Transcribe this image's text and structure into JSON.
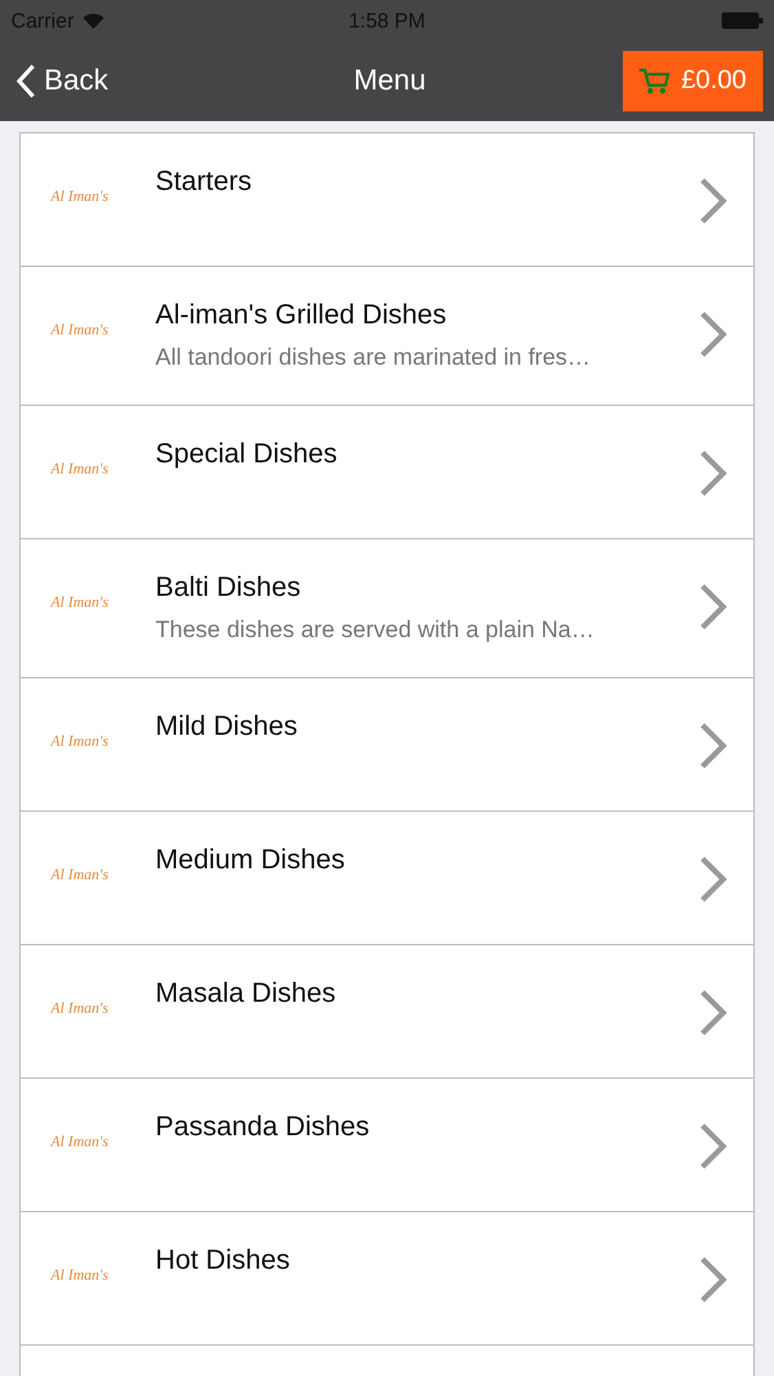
{
  "status_bar": {
    "carrier": "Carrier",
    "time": "1:58 PM"
  },
  "nav": {
    "back": "Back",
    "title": "Menu",
    "cart_total": "£0.00"
  },
  "items": [
    {
      "logo": "Al Iman's",
      "title": "Starters"
    },
    {
      "logo": "Al Iman's",
      "title": "Al-iman's Grilled Dishes",
      "subtitle": "All tandoori dishes are marinated in fres…"
    },
    {
      "logo": "Al Iman's",
      "title": "Special Dishes"
    },
    {
      "logo": "Al Iman's",
      "title": "Balti Dishes",
      "subtitle": "These dishes are served with a plain Na…"
    },
    {
      "logo": "Al Iman's",
      "title": "Mild Dishes"
    },
    {
      "logo": "Al Iman's",
      "title": "Medium Dishes"
    },
    {
      "logo": "Al Iman's",
      "title": "Masala Dishes"
    },
    {
      "logo": "Al Iman's",
      "title": "Passanda Dishes"
    },
    {
      "logo": "Al Iman's",
      "title": "Hot Dishes"
    }
  ]
}
